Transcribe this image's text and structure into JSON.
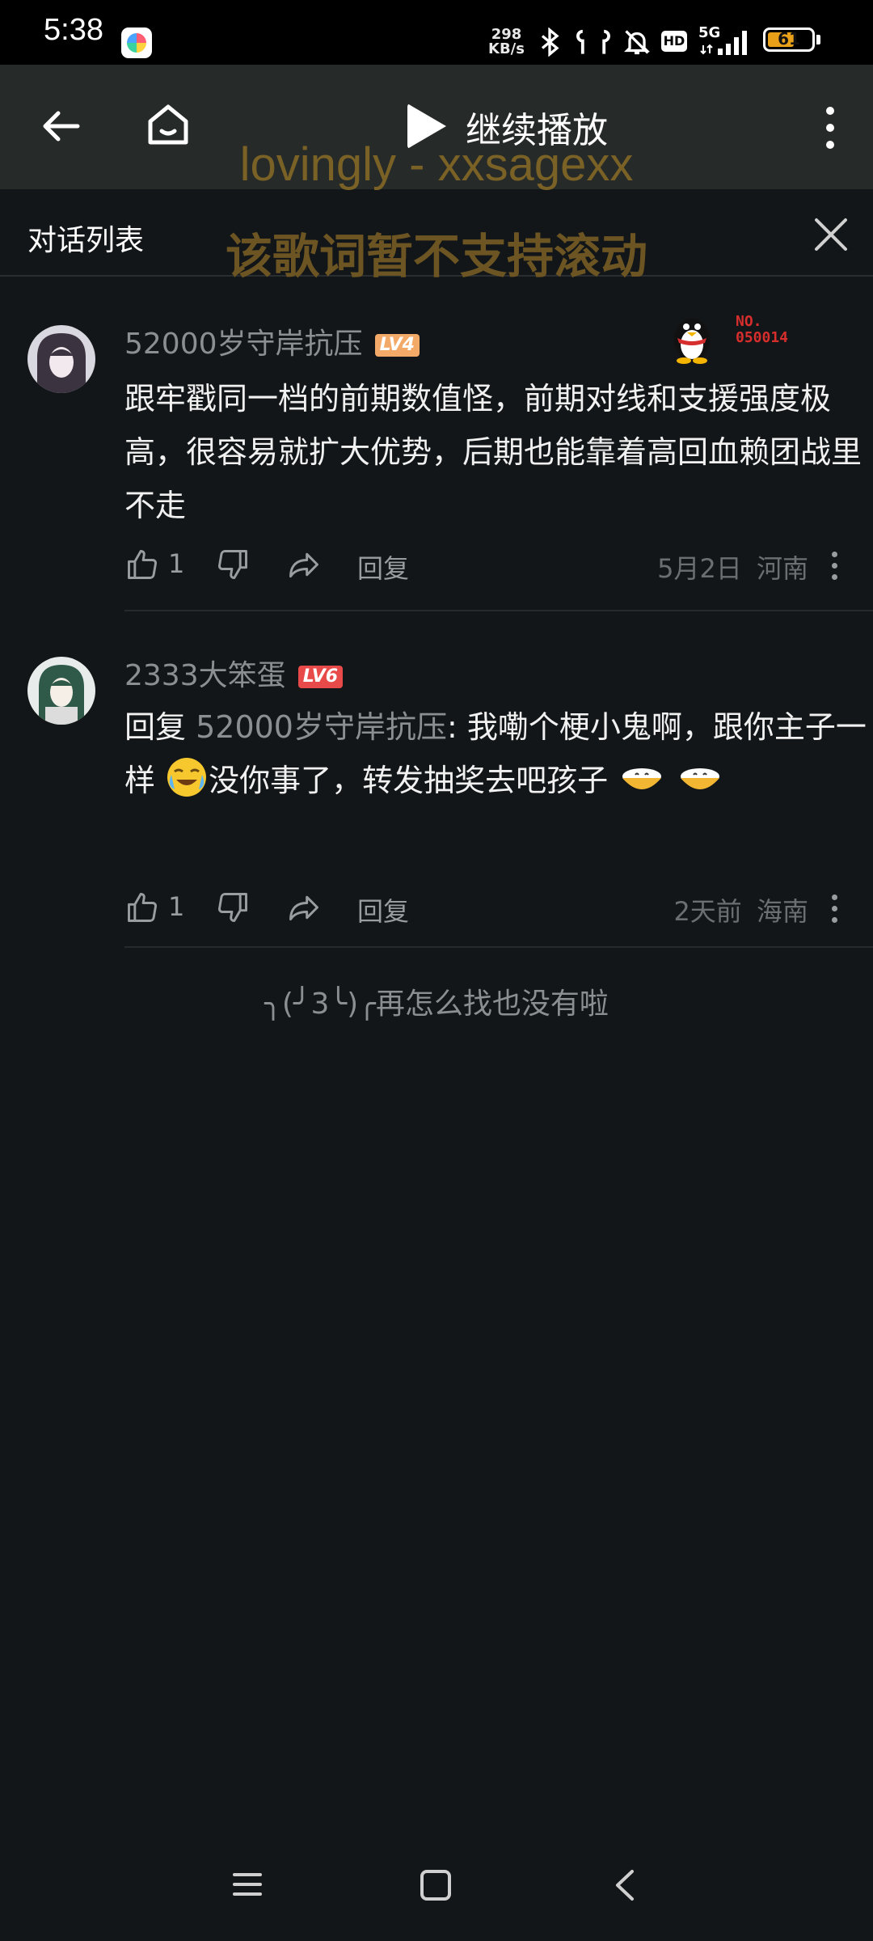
{
  "status": {
    "time": "5:38",
    "net_speed_value": "298",
    "net_speed_unit": "KB/s",
    "network": "5G",
    "hd": "HD",
    "battery": "61",
    "battery_level": 0.61
  },
  "topbar": {
    "continue_label": "继续播放",
    "lyric_title": "lovingly - xxsagexx"
  },
  "dialog": {
    "title": "对话列表",
    "lyric_note": "该歌词暂不支持滚动"
  },
  "comments": [
    {
      "username": "52000岁守岸抗压",
      "level": "LV4",
      "level_color": "#f3a967",
      "badge_no": "NO.",
      "badge_id": "050014",
      "content": "跟牢戳同一档的前期数值怪，前期对线和支援强度极高，很容易就扩大优势，后期也能靠着高回血赖团战里不走",
      "likes": "1",
      "reply_label": "回复",
      "date": "5月2日",
      "region": "河南"
    },
    {
      "username": "2333大笨蛋",
      "level": "LV6",
      "level_color": "#e84a4a",
      "reply_prefix": "回复 ",
      "mention": "52000岁守岸抗压",
      "content_a": ": 我嘞个梗小鬼啊，跟你主子一样",
      "content_b": "没你事了，转发抽奖去吧孩子",
      "likes": "1",
      "reply_label": "回复",
      "date": "2天前",
      "region": "海南"
    }
  ],
  "end_note": "╮(╯3╰)╭再怎么找也没有啦",
  "icons": {
    "back": "arrow-left-icon",
    "home": "home-icon",
    "play": "play-icon",
    "more": "more-vertical-icon",
    "close": "close-icon",
    "like": "thumbs-up-icon",
    "dislike": "thumbs-down-icon",
    "share": "share-icon"
  },
  "colors": {
    "background": "#121618",
    "topbar": "#262a28",
    "lyric": "#7a6126"
  }
}
